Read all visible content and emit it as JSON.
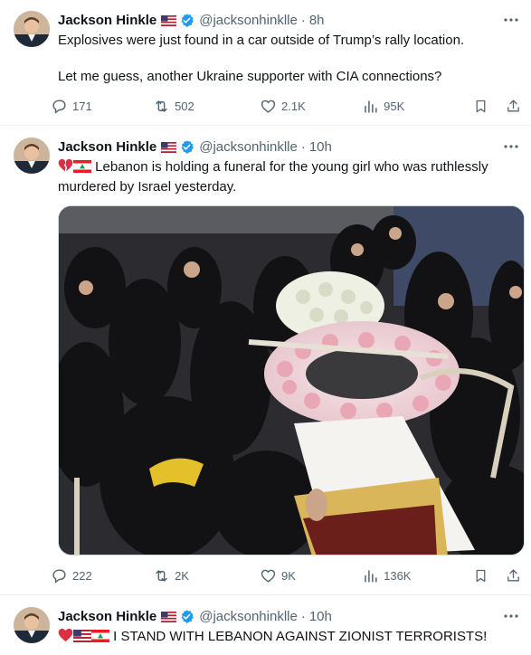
{
  "tweets": [
    {
      "name": "Jackson Hinkle",
      "handle": "@jacksonhinklle",
      "separator": "·",
      "time": "8h",
      "lines": [
        "Explosives were just found in a car outside of Trump’s rally location.",
        "Let me guess, another Ukraine supporter with CIA connections?"
      ],
      "stats": {
        "replies": "171",
        "reposts": "502",
        "likes": "2.1K",
        "views": "95K"
      }
    },
    {
      "name": "Jackson Hinkle",
      "handle": "@jacksonhinklle",
      "separator": "·",
      "time": "10h",
      "lines": [
        "Lebanon is holding a funeral for the young girl who was ruthlessly murdered by Israel yesterday."
      ],
      "emoji_prefix": [
        "broken-heart-emoji",
        "lebanon-flag-emoji"
      ],
      "stats": {
        "replies": "222",
        "reposts": "2K",
        "likes": "9K",
        "views": "136K"
      }
    },
    {
      "name": "Jackson Hinkle",
      "handle": "@jacksonhinklle",
      "separator": "·",
      "time": "10h",
      "lines": [
        "I STAND WITH LEBANON AGAINST ZIONIST TERRORISTS!"
      ],
      "emoji_prefix": [
        "red-heart-emoji",
        "us-flag-emoji",
        "lebanon-flag-emoji"
      ]
    }
  ],
  "icons": [
    "reply-icon",
    "repost-icon",
    "like-icon",
    "views-icon",
    "bookmark-icon",
    "share-icon",
    "verified-badge-icon",
    "more-icon"
  ],
  "colors": {
    "text": "#0f1419",
    "muted": "#536471",
    "verified": "#1d9bf0",
    "divider": "#eff3f4"
  }
}
